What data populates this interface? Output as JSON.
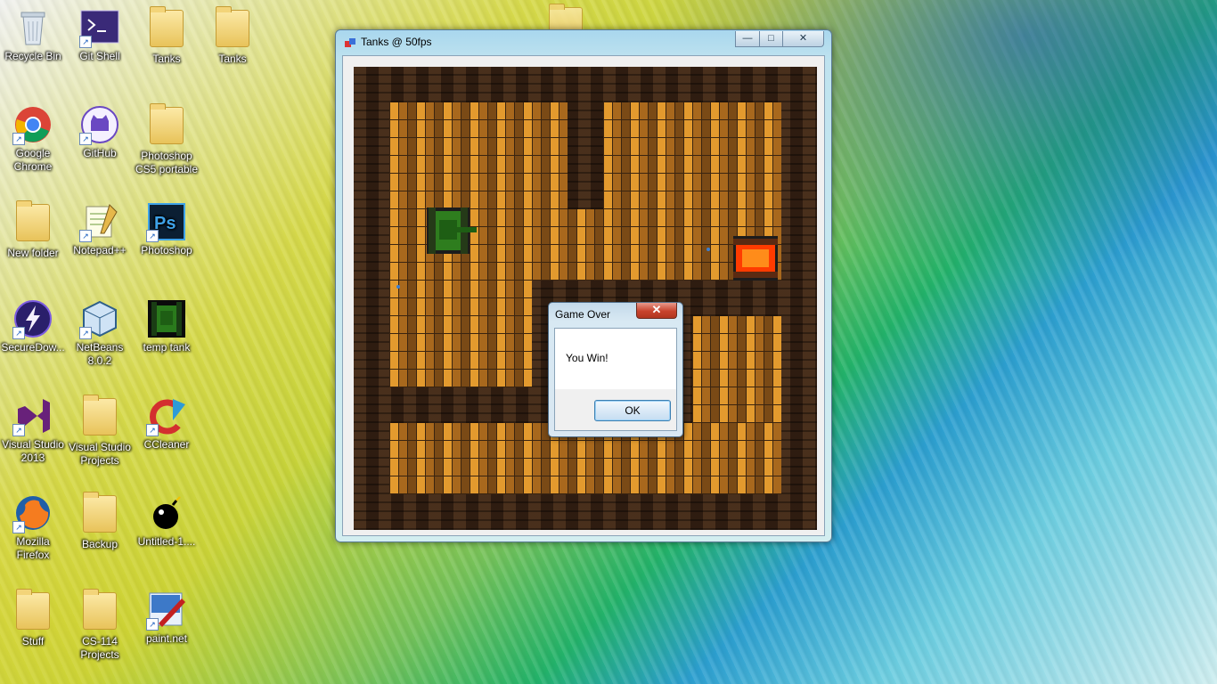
{
  "desktop": {
    "icons": [
      {
        "label": "Recycle Bin",
        "icon": "recycle-bin-icon"
      },
      {
        "label": "Git Shell",
        "icon": "terminal-icon"
      },
      {
        "label": "Tanks",
        "icon": "folder-icon"
      },
      {
        "label": "Tanks",
        "icon": "zip-folder-icon"
      },
      {
        "label": "Google Chrome",
        "icon": "chrome-icon"
      },
      {
        "label": "GitHub",
        "icon": "github-icon"
      },
      {
        "label": "Photoshop CS5 portable",
        "icon": "folder-icon"
      },
      {
        "label": "New folder",
        "icon": "folder-icon"
      },
      {
        "label": "Notepad++",
        "icon": "notepadpp-icon"
      },
      {
        "label": "Photoshop",
        "icon": "photoshop-icon"
      },
      {
        "label": "SecureDow...",
        "icon": "lightning-icon"
      },
      {
        "label": "NetBeans 8.0.2",
        "icon": "netbeans-icon"
      },
      {
        "label": "temp tank",
        "icon": "tank-image-icon"
      },
      {
        "label": "Visual Studio 2013",
        "icon": "visual-studio-icon"
      },
      {
        "label": "Visual Studio Projects",
        "icon": "folder-icon"
      },
      {
        "label": "CCleaner",
        "icon": "ccleaner-icon"
      },
      {
        "label": "Mozilla Firefox",
        "icon": "firefox-icon"
      },
      {
        "label": "Backup",
        "icon": "folder-icon"
      },
      {
        "label": "Untitled-1....",
        "icon": "bomb-icon"
      },
      {
        "label": "Stuff",
        "icon": "folder-icon"
      },
      {
        "label": "CS-114 Projects",
        "icon": "folder-icon"
      },
      {
        "label": "paint.net",
        "icon": "paintnet-icon"
      }
    ]
  },
  "window": {
    "title": "Tanks @ 50fps",
    "minimize_label": "—",
    "maximize_label": "□",
    "close_label": "✕"
  },
  "game": {
    "player_tank_color": "#2e7d1e",
    "enemy_tank_color": "#ff6a00"
  },
  "dialog": {
    "title": "Game Over",
    "close_label": "✕",
    "message": "You Win!",
    "ok_label": "OK"
  }
}
